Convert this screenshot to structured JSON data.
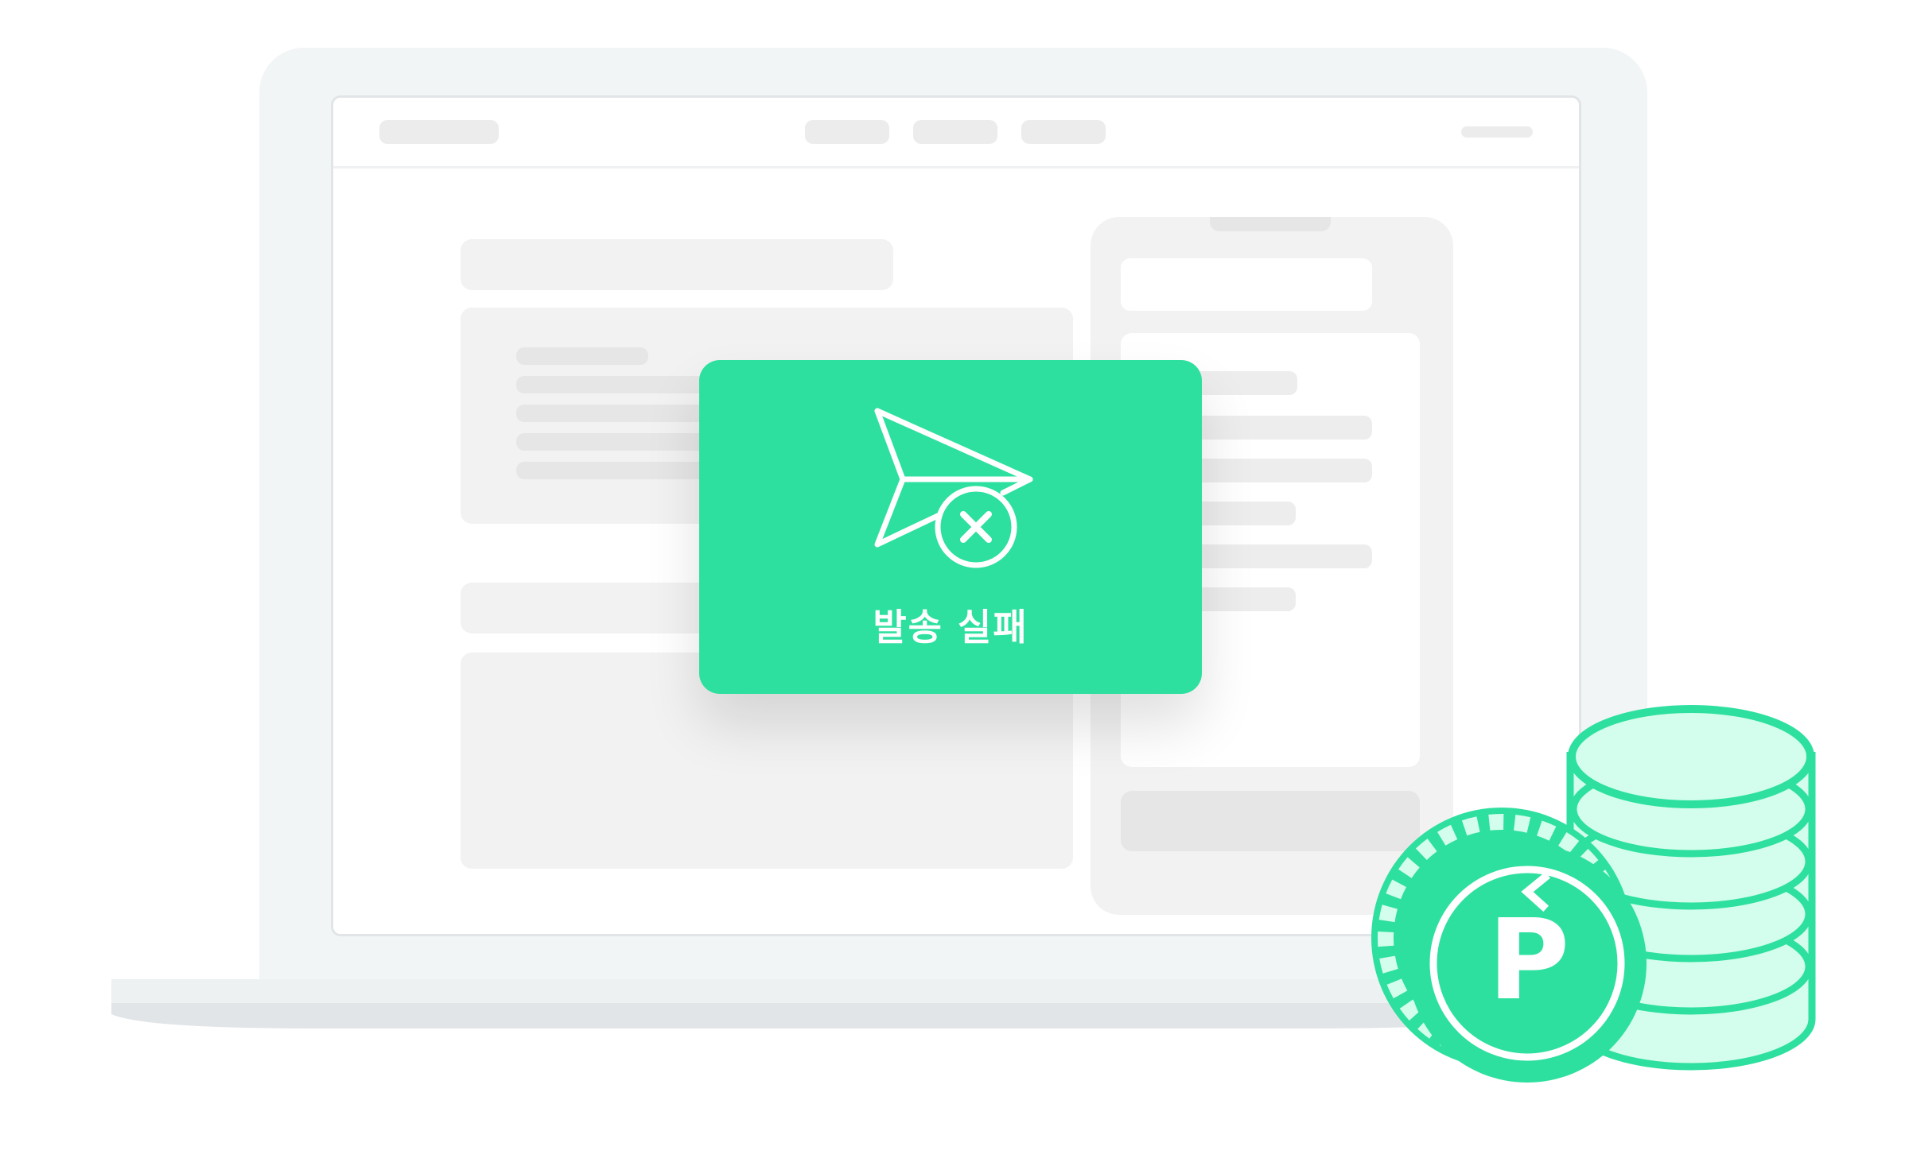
{
  "dialog": {
    "label": "발송 실패",
    "icon": "send-failed-icon"
  },
  "coins": {
    "badge_letter": "P",
    "icon": "point-coin-icon",
    "stack_icon": "coin-stack-icon"
  },
  "colors": {
    "accent": "#2ee09f",
    "accent_light": "#d3fdec",
    "lid": "#f2f5f6",
    "placeholder": "#ececec"
  }
}
